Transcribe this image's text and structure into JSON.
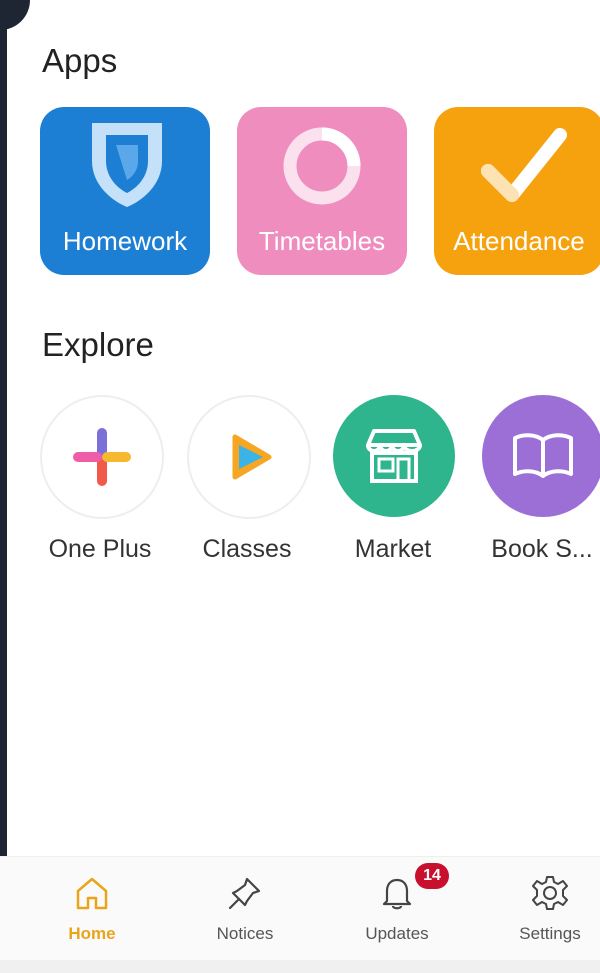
{
  "sections": {
    "apps_title": "Apps",
    "explore_title": "Explore"
  },
  "apps": [
    {
      "label": "Homework",
      "color": "#1d7fd3",
      "icon": "shield-icon"
    },
    {
      "label": "Timetables",
      "color": "#ef8dbf",
      "icon": "ring-icon"
    },
    {
      "label": "Attendance",
      "color": "#f6a20f",
      "icon": "checkmark-icon"
    }
  ],
  "explore": [
    {
      "label": "One Plus",
      "icon": "colorful-plus-icon"
    },
    {
      "label": "Classes",
      "icon": "play-icon"
    },
    {
      "label": "Market",
      "color": "#2fb58e",
      "icon": "storefront-icon"
    },
    {
      "label": "Book S...",
      "color": "#9b6fd6",
      "icon": "open-book-icon"
    }
  ],
  "bottom_nav": {
    "home": "Home",
    "notices": "Notices",
    "updates": "Updates",
    "settings": "Settings",
    "updates_badge": "14",
    "active_color": "#e9a41a",
    "badge_color": "#c8102e"
  }
}
